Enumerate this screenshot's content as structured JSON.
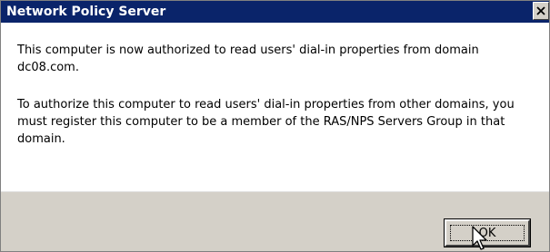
{
  "window": {
    "title": "Network Policy Server",
    "close_glyph": "✕"
  },
  "message": {
    "line1": "This computer is now authorized to read users' dial-in properties from domain dc08.com.",
    "line2": "To authorize this computer to read users' dial-in properties from other domains, you must register this computer to be a member of the RAS/NPS Servers Group in that domain."
  },
  "buttons": {
    "ok_label": "OK"
  },
  "icons": {
    "close": "close-icon",
    "cursor": "mouse-pointer-icon"
  },
  "colors": {
    "titlebar": "#0a246a",
    "footer": "#d4d0c8"
  }
}
